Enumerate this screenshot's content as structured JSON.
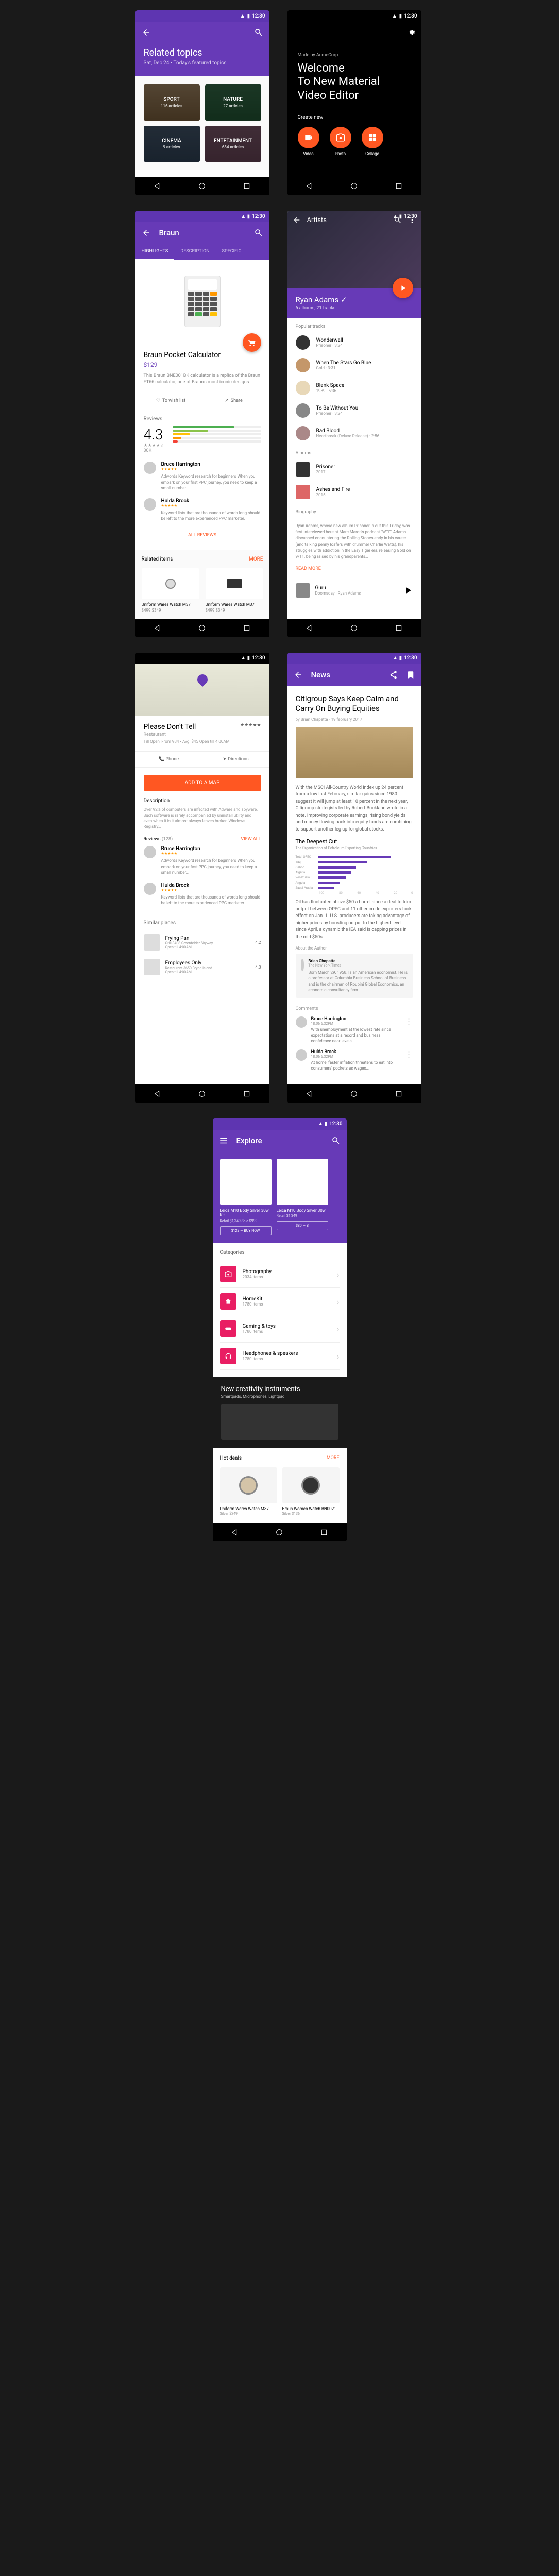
{
  "status_time": "12:30",
  "s1": {
    "title": "Related topics",
    "subtitle": "Sat, Dec 24 • Today's featured topics",
    "tiles": [
      {
        "label": "SPORT",
        "sub": "116 articles"
      },
      {
        "label": "NATURE",
        "sub": "27 articles"
      },
      {
        "label": "CINEMA",
        "sub": "9 articles"
      },
      {
        "label": "ENTETAINMENT",
        "sub": "684 articles"
      }
    ]
  },
  "s2": {
    "made_by": "Made by AcmeCorp",
    "welcome_l1": "Welcome",
    "welcome_l2": "To New Material",
    "welcome_l3": "Video Editor",
    "create_new": "Create new",
    "buttons": [
      {
        "label": "Video"
      },
      {
        "label": "Photo"
      },
      {
        "label": "Collage"
      }
    ]
  },
  "s3": {
    "title": "Braun",
    "tabs": [
      "HIGHLIGHTS",
      "DESCRIPTION",
      "SPECIFIC"
    ],
    "product_name": "Braun Pocket Calculator",
    "price": "$129",
    "description": "This Braun BNE001BK calculator is a replica of the Braun ET66 calculator, one of Braun's most iconic designs.",
    "wish": "To wish list",
    "share": "Share",
    "reviews_label": "Reviews",
    "score": "4.3",
    "stars_text": "★★★★☆",
    "count": "30K",
    "reviews": [
      {
        "name": "Bruce Harrington",
        "text": "Adwords Keyword research for beginners When you embark on your first PPC journey, you need to keep a small number…"
      },
      {
        "name": "Hulda Brock",
        "text": "Keyword lists that are thousands of words long should be left to the more experienced PPC marketer."
      }
    ],
    "all_reviews": "ALL REVIEWS",
    "related_label": "Related items",
    "more": "MORE",
    "related": [
      {
        "name": "Uniform Wares Watch M37",
        "price": "$499 $349"
      },
      {
        "name": "Uniform Wares Watch M37",
        "price": "$499 $349"
      }
    ]
  },
  "s4": {
    "back_title": "Artists",
    "artist": "Ryan Adams",
    "meta": "6 albums, 21 tracks",
    "popular_label": "Popular tracks",
    "tracks": [
      {
        "name": "Wonderwall",
        "sub": "Prisoner · 3:24"
      },
      {
        "name": "When The Stars Go Blue",
        "sub": "Gold · 3:31"
      },
      {
        "name": "Blank Space",
        "sub": "1989 · 5:36"
      },
      {
        "name": "To Be Without You",
        "sub": "Prisoner · 3:24"
      },
      {
        "name": "Bad Blood",
        "sub": "Heartbreak (Deluxe Release) · 2:56"
      }
    ],
    "albums_label": "Albums",
    "albums": [
      {
        "name": "Prisoner",
        "sub": "2017"
      },
      {
        "name": "Ashes and Fire",
        "sub": "2015"
      }
    ],
    "bio_label": "Biography",
    "bio": "Ryan Adams, whose new album Prisoner is out this Friday, was first interviewed here at Marc Maron's podcast \"WTF\" Adams discussed encountering the Rolling Stones early in his career (and talking penny loafers with drummer Charlie Watts), his struggles with addiction in the Easy Tiger era, releasing Gold on 9/11, being raised by his grandparents…",
    "read_more": "READ MORE",
    "now_playing": {
      "name": "Guru",
      "sub": "Doomsday · Ryan Adams"
    }
  },
  "s5": {
    "name": "Please Don't Tell",
    "type": "Restaurant",
    "meta": "Till Open, From 984 • Avg. $45\nOpen till 4:00AM",
    "stars": "★★★★★",
    "phone": "Phone",
    "directions": "Directions",
    "add_to_map": "ADD TO A MAP",
    "desc_label": "Description",
    "desc": "Over 92% of computers are infected with Adware and spyware. Such software is rarely accompanied by uninstall utility and even when it is it almost always leaves broken Windows Registry…",
    "reviews_label": "Reviews",
    "reviews_count": "(128)",
    "view_all": "VIEW ALL",
    "reviews": [
      {
        "name": "Bruce Harrington",
        "text": "Adwords Keyword research for beginners When you embark on your first PPC journey, you need to keep a small number…"
      },
      {
        "name": "Hulda Brock",
        "text": "Keyword lists that are thousands of words long should be left to the more experienced PPC marketer."
      }
    ],
    "similar_label": "Similar places",
    "places": [
      {
        "name": "Frying Pan",
        "meta": "Grill\n3408 Greenfelder Skyway",
        "dist": "4.2",
        "open": "Open till 4:00AM"
      },
      {
        "name": "Employees Only",
        "meta": "Restaurant\n3650 Bryon Island",
        "dist": "4.3",
        "open": "Open till 4:00AM"
      }
    ]
  },
  "s6": {
    "appbar": "News",
    "headline": "Citigroup Says Keep Calm and Carry On Buying Equities",
    "byline": "by Brian Chapatta · 19 february 2017",
    "p1": "With the MSCI All-Country World Index up 24 percent from a low last February, similar gains since 1980 suggest it will jump at least 10 percent in the next year, Citigroup strategists led by Robert Buckland wrote in a note. Improving corporate earnings, rising bond yields and money flowing back into equity funds are combining to support another leg up for global stocks.",
    "sub_head": "The Deepest Cut",
    "sub_sub": "The Organization of Petroleum Exporting Countries",
    "p2": "Oil has fluctuated above $50 a barrel since a deal to trim output between OPEC and 11 other crude exporters took effect on Jan. 1. U.S. producers are taking advantage of higher prices by boosting output to the highest level since April, a dynamic the IEA said is capping prices in the mid-$50s.",
    "author_label": "About the Author",
    "author_name": "Brian Chapatta",
    "author_org": "The New York Times",
    "author_bio": "Born March 29, 1958. Is an American economist. He is a professor at Columbia Business School of Business and is the chairman of Roubini Global Economics, an economic consultancy firm…",
    "comments_label": "Comments",
    "comments": [
      {
        "name": "Bruce Harrington",
        "date": "18.06 6:32PM",
        "text": "With unemployment at the lowest rate since expectations at a record and business confidence near levels…"
      },
      {
        "name": "Hulda Brock",
        "date": "18.06 6:32PM",
        "text": "At home, faster inflation threatens to eat into consumers' pockets as wages…"
      }
    ]
  },
  "chart_data": {
    "type": "bar",
    "orientation": "horizontal",
    "title": "The Deepest Cut",
    "subtitle": "The Organization of Petroleum Exporting Countries",
    "xlabel": "",
    "ylabel": "",
    "x_ticks": [
      -100,
      -80,
      -60,
      -40,
      -20,
      0
    ],
    "categories": [
      "Total OPEC",
      "Iraq",
      "Gabon",
      "Algeria",
      "Venezuela",
      "Angola",
      "Saudi Arabia"
    ],
    "values": [
      -100,
      -68,
      -52,
      -45,
      -38,
      -30,
      -22
    ]
  },
  "s7": {
    "title": "Explore",
    "items": [
      {
        "name": "Leica M10 Body Silver 30w Kit",
        "price": "Retail $1,349 Sale $999",
        "btn": "$129 — BUY NOW"
      },
      {
        "name": "Leica M10 Body Silver 30w",
        "price": "Retail $1,349",
        "btn": "$80 — B"
      }
    ],
    "cats_label": "Categories",
    "cats": [
      {
        "name": "Photography",
        "count": "2034 items"
      },
      {
        "name": "HomeKit",
        "count": "1780 items"
      },
      {
        "name": "Gaming & toys",
        "count": "1780 items"
      },
      {
        "name": "Headphones & speakers",
        "count": "1780 items"
      }
    ],
    "creativity_title": "New creativity instruments",
    "creativity_sub": "Smartpads, Microphones, Lightpad",
    "hot_label": "Hot deals",
    "more": "MORE",
    "hot": [
      {
        "name": "Uniform Wares Watch M37",
        "price": "Silver $249"
      },
      {
        "name": "Braun Women Watch BN0021",
        "price": "Silver $136"
      }
    ]
  }
}
